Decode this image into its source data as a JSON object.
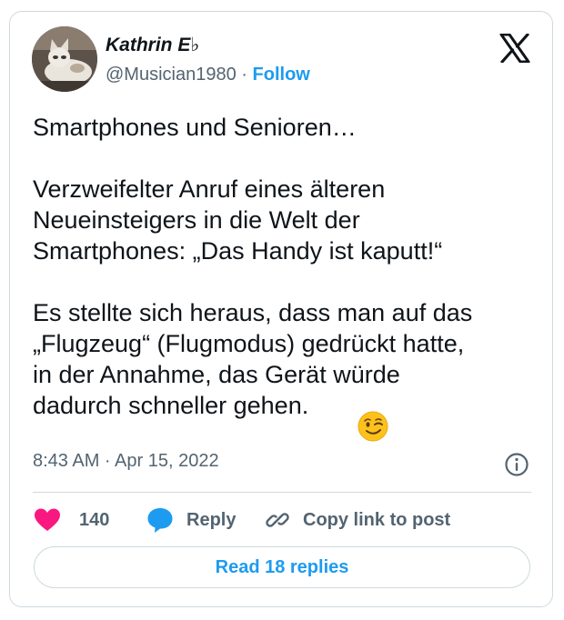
{
  "author": {
    "name": "Kathrin E♭",
    "handle": "@Musician1980",
    "separator": "·",
    "follow_label": "Follow"
  },
  "icons": {
    "logo": "x-logo-icon",
    "info": "info-icon",
    "like": "heart-icon",
    "reply": "speech-bubble-icon",
    "copy": "link-icon",
    "emoji": "winking-face-emoji"
  },
  "colors": {
    "accent": "#1d9bf0",
    "like": "#f91880",
    "text": "#0f1419",
    "muted": "#536471",
    "border": "#cfd9de"
  },
  "tweet": {
    "text": "Smartphones und Senioren…\n\nVerzweifelter Anruf eines älteren\nNeueinsteigers in die Welt der\nSmartphones: „Das Handy ist kaputt!“\n\nEs stellte sich heraus, dass man auf das\n„Flugzeug“ (Flugmodus) gedrückt hatte,\nin der Annahme, das Gerät würde\ndadurch schneller gehen.",
    "timestamp": "8:43 AM · Apr 15, 2022"
  },
  "actions": {
    "like_count": "140",
    "reply_label": "Reply",
    "copy_label": "Copy link to post"
  },
  "footer": {
    "read_replies_label": "Read 18 replies"
  }
}
